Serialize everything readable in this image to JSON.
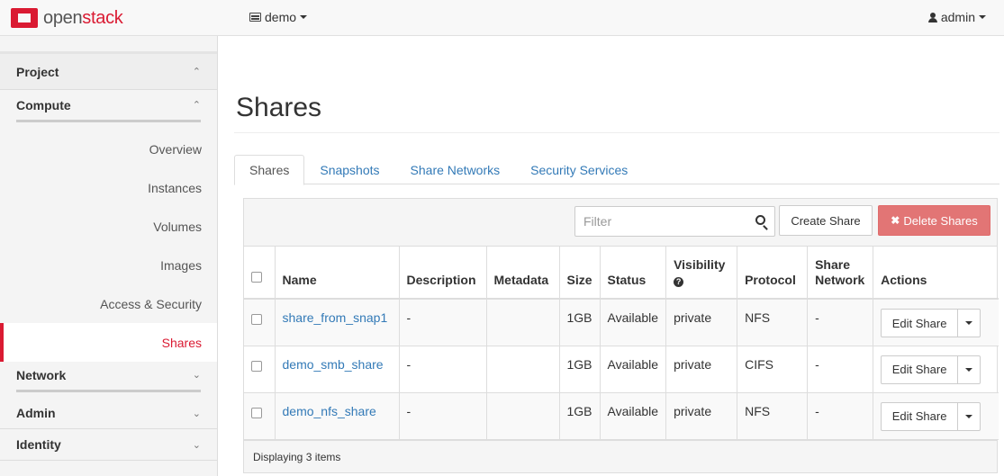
{
  "brand": {
    "part1": "open",
    "part2": "stack"
  },
  "project_switcher": {
    "label": "demo"
  },
  "user_menu": {
    "label": "admin"
  },
  "sidebar": {
    "project": "Project",
    "compute": "Compute",
    "items": [
      {
        "label": "Overview"
      },
      {
        "label": "Instances"
      },
      {
        "label": "Volumes"
      },
      {
        "label": "Images"
      },
      {
        "label": "Access & Security"
      },
      {
        "label": "Shares"
      }
    ],
    "network": "Network",
    "admin": "Admin",
    "identity": "Identity"
  },
  "page_title": "Shares",
  "tabs": [
    {
      "label": "Shares"
    },
    {
      "label": "Snapshots"
    },
    {
      "label": "Share Networks"
    },
    {
      "label": "Security Services"
    }
  ],
  "toolbar": {
    "filter_placeholder": "Filter",
    "create_label": "Create Share",
    "delete_label": "Delete Shares"
  },
  "table": {
    "headers": {
      "name": "Name",
      "description": "Description",
      "metadata": "Metadata",
      "size": "Size",
      "status": "Status",
      "visibility": "Visibility",
      "protocol": "Protocol",
      "share_network_1": "Share",
      "share_network_2": "Network",
      "actions": "Actions"
    },
    "rows": [
      {
        "name": "share_from_snap1",
        "description": "-",
        "metadata": "",
        "size": "1GB",
        "status": "Available",
        "visibility": "private",
        "protocol": "NFS",
        "share_network": "-",
        "action": "Edit Share"
      },
      {
        "name": "demo_smb_share",
        "description": "-",
        "metadata": "",
        "size": "1GB",
        "status": "Available",
        "visibility": "private",
        "protocol": "CIFS",
        "share_network": "-",
        "action": "Edit Share"
      },
      {
        "name": "demo_nfs_share",
        "description": "-",
        "metadata": "",
        "size": "1GB",
        "status": "Available",
        "visibility": "private",
        "protocol": "NFS",
        "share_network": "-",
        "action": "Edit Share"
      }
    ],
    "footer": "Displaying 3 items"
  },
  "colors": {
    "brand_red": "#da1a32",
    "link_blue": "#337ab7",
    "delete_red": "#e27575"
  }
}
